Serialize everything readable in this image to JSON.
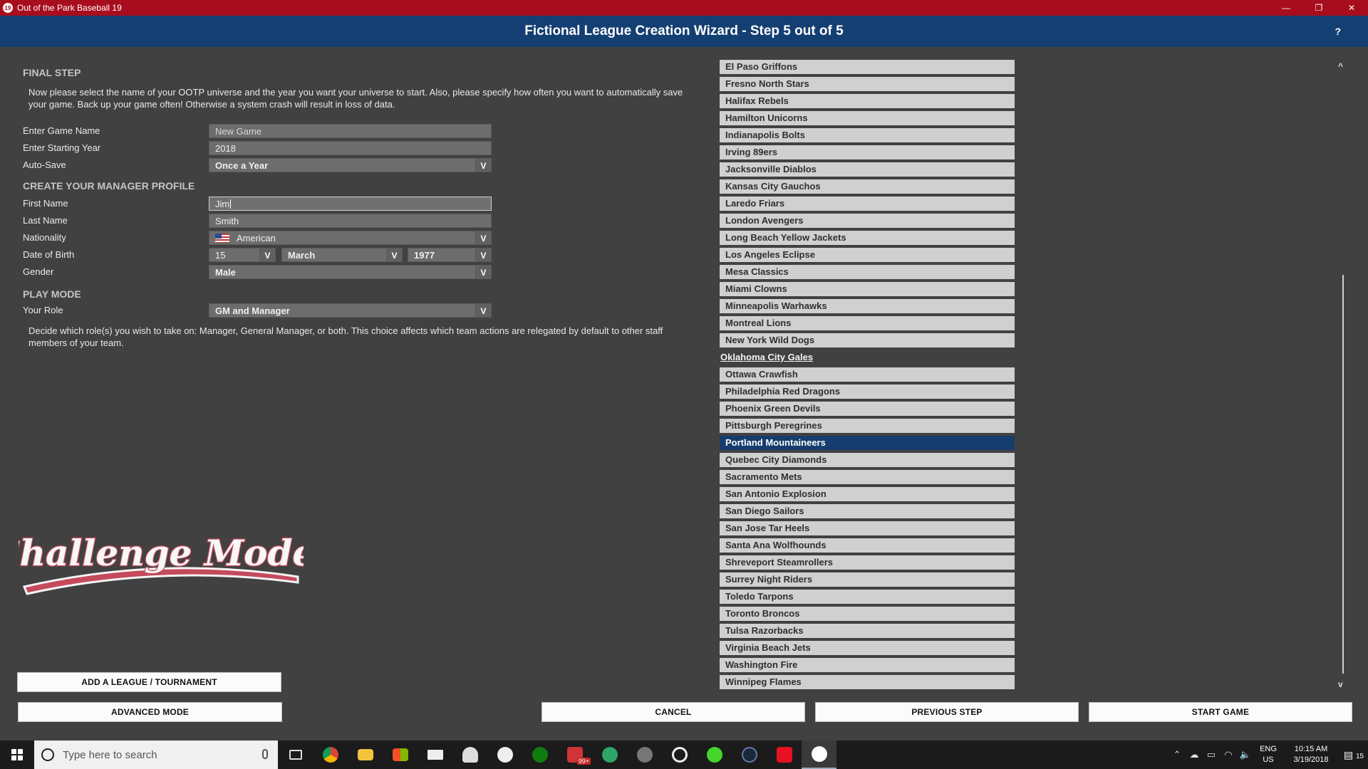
{
  "window": {
    "title": "Out of the Park Baseball 19",
    "icon_label": "19",
    "controls": [
      "—",
      "❐",
      "✕"
    ]
  },
  "header": {
    "title": "Fictional League Creation Wizard - Step 5 out of 5",
    "help": "?"
  },
  "final_step": {
    "title": "FINAL STEP",
    "description": "Now please select the name of your OOTP universe and the year you want your universe to start. Also, please specify how often you want to automatically save your game. Back up your game often! Otherwise a system crash will result in loss of data.",
    "game_name_label": "Enter Game Name",
    "game_name_value": "New Game",
    "start_year_label": "Enter Starting Year",
    "start_year_value": "2018",
    "autosave_label": "Auto-Save",
    "autosave_value": "Once a Year"
  },
  "manager_profile": {
    "title": "CREATE YOUR MANAGER PROFILE",
    "first_name_label": "First Name",
    "first_name_value": "Jim",
    "last_name_label": "Last Name",
    "last_name_value": "Smith",
    "nationality_label": "Nationality",
    "nationality_value": "American",
    "dob_label": "Date of Birth",
    "dob_day": "15",
    "dob_month": "March",
    "dob_year": "1977",
    "gender_label": "Gender",
    "gender_value": "Male"
  },
  "play_mode": {
    "title": "PLAY MODE",
    "role_label": "Your Role",
    "role_value": "GM and Manager",
    "description": "Decide which role(s) you wish to take on: Manager, General Manager, or both.  This choice affects which team actions are relegated by default to other staff members of your team."
  },
  "logo": {
    "text": "Challenge Mode!"
  },
  "buttons": {
    "add_league": "ADD A LEAGUE / TOURNAMENT",
    "advanced_mode": "ADVANCED MODE",
    "cancel": "CANCEL",
    "previous_step": "PREVIOUS STEP",
    "start_game": "START GAME"
  },
  "teams": [
    "El Paso Griffons",
    "Fresno North Stars",
    "Halifax Rebels",
    "Hamilton Unicorns",
    "Indianapolis Bolts",
    "Irving 89ers",
    "Jacksonville Diablos",
    "Kansas City Gauchos",
    "Laredo Friars",
    "London Avengers",
    "Long Beach Yellow Jackets",
    "Los Angeles Eclipse",
    "Mesa Classics",
    "Miami Clowns",
    "Minneapolis Warhawks",
    "Montreal Lions",
    "New York Wild Dogs",
    "Oklahoma City Gales",
    "Ottawa Crawfish",
    "Philadelphia Red Dragons",
    "Phoenix Green Devils",
    "Pittsburgh Peregrines",
    "Portland Mountaineers",
    "Quebec City Diamonds",
    "Sacramento Mets",
    "San Antonio Explosion",
    "San Diego Sailors",
    "San Jose Tar Heels",
    "Santa Ana Wolfhounds",
    "Shreveport Steamrollers",
    "Surrey Night Riders",
    "Toledo Tarpons",
    "Toronto Broncos",
    "Tulsa Razorbacks",
    "Virginia Beach Jets",
    "Washington Fire",
    "Winnipeg Flames"
  ],
  "team_plain": "Oklahoma City Gales",
  "team_selected": "Portland Mountaineers",
  "taskbar": {
    "search_placeholder": "Type here to search",
    "mail_badge": "99+",
    "lang_top": "ENG",
    "lang_bottom": "US",
    "time": "10:15 AM",
    "date": "3/19/2018",
    "notification_count": "15"
  }
}
